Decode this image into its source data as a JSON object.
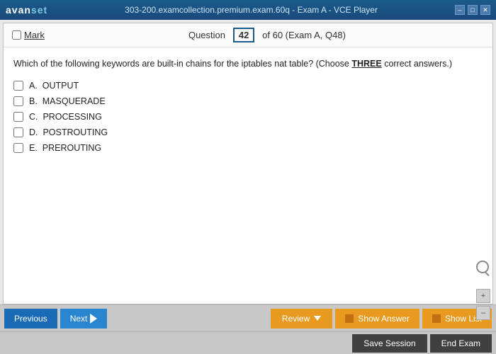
{
  "titleBar": {
    "logo_avan": "avan",
    "logo_set": "set",
    "center": "303-200.examcollection.premium.exam.60q - Exam A - VCE Player",
    "btn_min": "–",
    "btn_max": "□",
    "btn_close": "✕"
  },
  "questionHeader": {
    "mark_label": "Mark",
    "question_label": "Question",
    "question_number": "42",
    "of_total": "of 60 (Exam A, Q48)"
  },
  "questionContent": {
    "question_text_plain": "Which of the following keywords are built-in chains for the iptables nat table? (Choose ",
    "question_text_bold": "THREE",
    "question_text_end": " correct answers.)",
    "options": [
      {
        "id": "A",
        "label": "A.",
        "text": "OUTPUT"
      },
      {
        "id": "B",
        "label": "B.",
        "text": "MASQUERADE"
      },
      {
        "id": "C",
        "label": "C.",
        "text": "PROCESSING"
      },
      {
        "id": "D",
        "label": "D.",
        "text": "POSTROUTING"
      },
      {
        "id": "E",
        "label": "E.",
        "text": "PREROUTING"
      }
    ]
  },
  "toolbar": {
    "prev_label": "Previous",
    "next_label": "Next",
    "review_label": "Review",
    "show_answer_label": "Show Answer",
    "show_list_label": "Show List",
    "save_session_label": "Save Session",
    "end_exam_label": "End Exam"
  },
  "zoom": {
    "plus": "+",
    "minus": "–"
  }
}
